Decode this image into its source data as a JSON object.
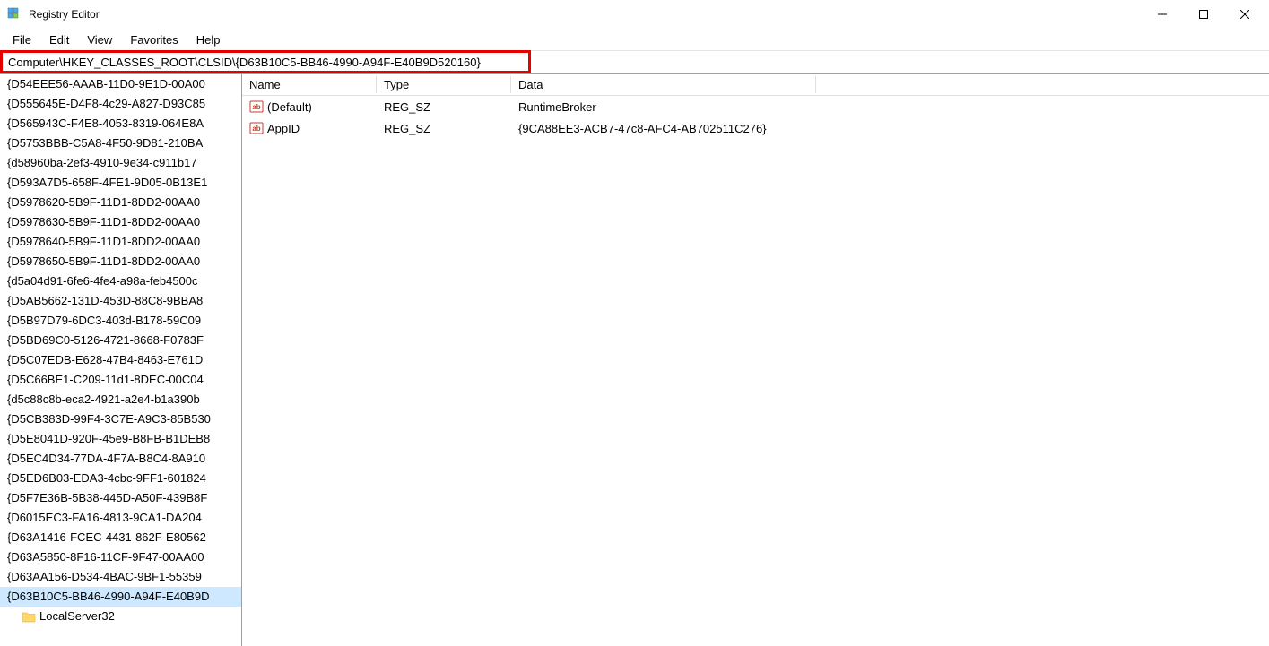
{
  "window": {
    "title": "Registry Editor"
  },
  "menu": {
    "file": "File",
    "edit": "Edit",
    "view": "View",
    "favorites": "Favorites",
    "help": "Help"
  },
  "address": {
    "path": "Computer\\HKEY_CLASSES_ROOT\\CLSID\\{D63B10C5-BB46-4990-A94F-E40B9D520160}"
  },
  "tree": {
    "items": [
      "{D54EEE56-AAAB-11D0-9E1D-00A00",
      "{D555645E-D4F8-4c29-A827-D93C85",
      "{D565943C-F4E8-4053-8319-064E8A",
      "{D5753BBB-C5A8-4F50-9D81-210BA",
      "{d58960ba-2ef3-4910-9e34-c911b17",
      "{D593A7D5-658F-4FE1-9D05-0B13E1",
      "{D5978620-5B9F-11D1-8DD2-00AA0",
      "{D5978630-5B9F-11D1-8DD2-00AA0",
      "{D5978640-5B9F-11D1-8DD2-00AA0",
      "{D5978650-5B9F-11D1-8DD2-00AA0",
      "{d5a04d91-6fe6-4fe4-a98a-feb4500c",
      "{D5AB5662-131D-453D-88C8-9BBA8",
      "{D5B97D79-6DC3-403d-B178-59C09",
      "{D5BD69C0-5126-4721-8668-F0783F",
      "{D5C07EDB-E628-47B4-8463-E761D",
      "{D5C66BE1-C209-11d1-8DEC-00C04",
      "{d5c88c8b-eca2-4921-a2e4-b1a390b",
      "{D5CB383D-99F4-3C7E-A9C3-85B530",
      "{D5E8041D-920F-45e9-B8FB-B1DEB8",
      "{D5EC4D34-77DA-4F7A-B8C4-8A910",
      "{D5ED6B03-EDA3-4cbc-9FF1-601824",
      "{D5F7E36B-5B38-445D-A50F-439B8F",
      "{D6015EC3-FA16-4813-9CA1-DA204",
      "{D63A1416-FCEC-4431-862F-E80562",
      "{D63A5850-8F16-11CF-9F47-00AA00",
      "{D63AA156-D534-4BAC-9BF1-55359"
    ],
    "selected": "{D63B10C5-BB46-4990-A94F-E40B9D",
    "child": "LocalServer32"
  },
  "values": {
    "headers": {
      "name": "Name",
      "type": "Type",
      "data": "Data"
    },
    "rows": [
      {
        "name": "(Default)",
        "type": "REG_SZ",
        "data": "RuntimeBroker"
      },
      {
        "name": "AppID",
        "type": "REG_SZ",
        "data": "{9CA88EE3-ACB7-47c8-AFC4-AB702511C276}"
      }
    ]
  }
}
